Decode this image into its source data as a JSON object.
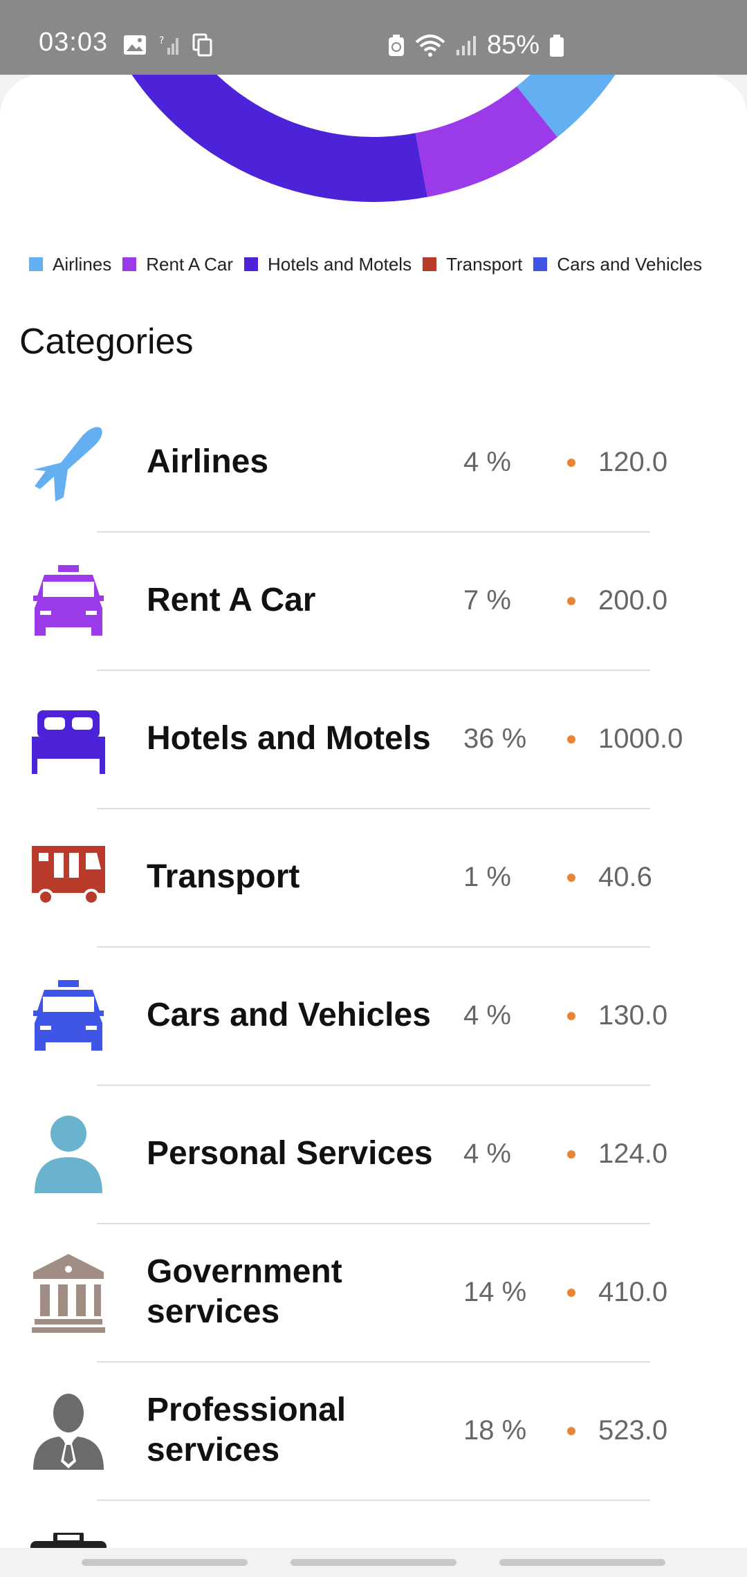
{
  "status_bar": {
    "time": "03:03",
    "battery": "85%"
  },
  "legend": [
    {
      "label": "Airlines",
      "color": "#64aef2"
    },
    {
      "label": "Rent A Car",
      "color": "#9a3ae8"
    },
    {
      "label": "Hotels and Motels",
      "color": "#4c23d8"
    },
    {
      "label": "Transport",
      "color": "#b83b2b"
    },
    {
      "label": "Cars and Vehicles",
      "color": "#3f55e6"
    }
  ],
  "section_title": "Categories",
  "categories": [
    {
      "name": "Airlines",
      "percent": "4 %",
      "amount": "120.0",
      "icon": "airplane-icon",
      "color": "#64aef2"
    },
    {
      "name": "Rent A Car",
      "percent": "7 %",
      "amount": "200.0",
      "icon": "taxi-icon",
      "color": "#9a3ae8"
    },
    {
      "name": "Hotels and Motels",
      "percent": "36 %",
      "amount": "1000.0",
      "icon": "bed-icon",
      "color": "#4c23d8"
    },
    {
      "name": "Transport",
      "percent": "1 %",
      "amount": "40.6",
      "icon": "truck-icon",
      "color": "#b83b2b"
    },
    {
      "name": "Cars and Vehicles",
      "percent": "4 %",
      "amount": "130.0",
      "icon": "taxi-icon",
      "color": "#3f55e6"
    },
    {
      "name": "Personal Services",
      "percent": "4 %",
      "amount": "124.0",
      "icon": "person-icon",
      "color": "#69b3cf"
    },
    {
      "name": "Government\nservices",
      "percent": "14 %",
      "amount": "410.0",
      "icon": "bank-icon",
      "color": "#a08d84"
    },
    {
      "name": "Professional\nservices",
      "percent": "18 %",
      "amount": "523.0",
      "icon": "businessman-icon",
      "color": "#6b6b6b"
    }
  ],
  "chart_data": {
    "type": "pie",
    "style": "donut",
    "categories": [
      "Airlines",
      "Rent A Car",
      "Hotels and Motels",
      "Transport",
      "Cars and Vehicles",
      "Personal Services",
      "Government services",
      "Professional services"
    ],
    "values": [
      120.0,
      200.0,
      1000.0,
      40.6,
      130.0,
      124.0,
      410.0,
      523.0
    ],
    "colors": [
      "#64aef2",
      "#9a3ae8",
      "#4c23d8",
      "#b83b2b",
      "#3f55e6",
      "#69b3cf",
      "#a08d84",
      "#6b6b6b"
    ]
  }
}
